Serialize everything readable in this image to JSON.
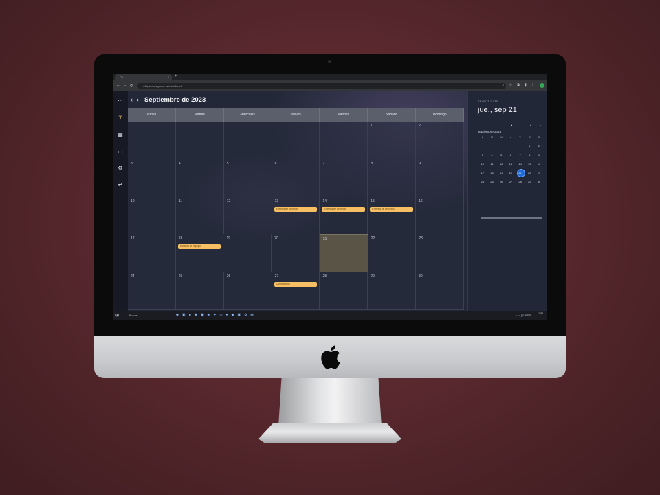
{
  "browser": {
    "tab_title": "C i",
    "tab_close": "×",
    "new_tab": "+",
    "url": "c4.lyaconta.grupo.es/dashboard",
    "nav_back": "←",
    "nav_forward": "→",
    "nav_reload": "⟳",
    "ext_icons": "⌕ ☆ ⧉ ⬇ ⋮"
  },
  "sidebar": {
    "icons": [
      {
        "name": "menu-icon",
        "glyph": "⋯"
      },
      {
        "name": "logo-icon",
        "glyph": "ɤ"
      },
      {
        "name": "dashboard-icon",
        "glyph": "▦"
      },
      {
        "name": "calendar-icon",
        "glyph": "▭"
      },
      {
        "name": "settings-icon",
        "glyph": "⚙"
      },
      {
        "name": "logout-icon",
        "glyph": "↵"
      }
    ]
  },
  "calendar": {
    "prev": "‹",
    "next": "›",
    "title": "Septiembre de 2023",
    "weekdays": [
      "Lunes",
      "Martes",
      "Miércoles",
      "Jueves",
      "Viernes",
      "Sábado",
      "Domingo"
    ],
    "weeks": [
      [
        {
          "d": ""
        },
        {
          "d": ""
        },
        {
          "d": ""
        },
        {
          "d": ""
        },
        {
          "d": ""
        },
        {
          "d": "1"
        },
        {
          "d": "2"
        }
      ],
      [
        {
          "d": "3"
        },
        {
          "d": "4"
        },
        {
          "d": "5"
        },
        {
          "d": "6"
        },
        {
          "d": "7"
        },
        {
          "d": "8"
        },
        {
          "d": "9"
        }
      ],
      [
        {
          "d": "10"
        },
        {
          "d": "11"
        },
        {
          "d": "12"
        },
        {
          "d": "13",
          "e": "Entrega de proyecto"
        },
        {
          "d": "14",
          "e": "Entrega de proyecto"
        },
        {
          "d": "15",
          "e": "Entrega de proyecto"
        },
        {
          "d": "16"
        }
      ],
      [
        {
          "d": "17"
        },
        {
          "d": "18",
          "e": "Reunión de equipo"
        },
        {
          "d": "19"
        },
        {
          "d": "20"
        },
        {
          "d": "21",
          "today": true
        },
        {
          "d": "22"
        },
        {
          "d": "23"
        }
      ],
      [
        {
          "d": "24"
        },
        {
          "d": "25"
        },
        {
          "d": "26"
        },
        {
          "d": "27",
          "e": "Cumpleaños"
        },
        {
          "d": "28"
        },
        {
          "d": "29"
        },
        {
          "d": "30"
        }
      ]
    ]
  },
  "panel": {
    "label": "SELECT DATE",
    "selected": "jue., sep 21",
    "mini_month": "septiembre 2023",
    "mini_dropdown": "▾",
    "mini_prev": "‹",
    "mini_next": "›",
    "mini_weekdays": [
      "L",
      "M",
      "M",
      "J",
      "V",
      "S",
      "D"
    ],
    "mini_weeks": [
      [
        "",
        "",
        "",
        "",
        "",
        "1",
        "2"
      ],
      [
        "3",
        "4",
        "5",
        "6",
        "7",
        "8",
        "9"
      ],
      [
        "10",
        "11",
        "12",
        "13",
        "14",
        "15",
        "16"
      ],
      [
        "17",
        "18",
        "19",
        "20",
        "21",
        "22",
        "23"
      ],
      [
        "24",
        "25",
        "26",
        "27",
        "28",
        "29",
        "30"
      ]
    ],
    "mini_selected": "21"
  },
  "taskbar": {
    "start": "⊞",
    "search": "Buscar",
    "apps": "◆▣■◉▣◈✦◇●◆▣✿◉",
    "tray": "^ ☁ 🔊 ESP",
    "clock": "17:54"
  }
}
